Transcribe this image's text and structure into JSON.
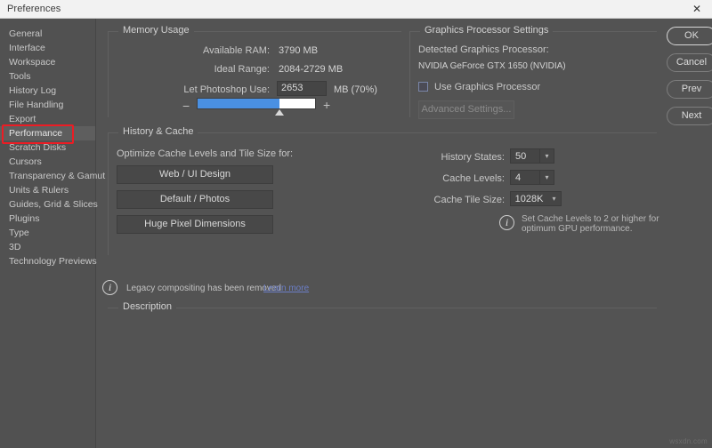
{
  "window": {
    "title": "Preferences",
    "close_icon": "close-icon"
  },
  "sidebar": {
    "items": [
      {
        "label": "General",
        "selected": false
      },
      {
        "label": "Interface",
        "selected": false
      },
      {
        "label": "Workspace",
        "selected": false
      },
      {
        "label": "Tools",
        "selected": false
      },
      {
        "label": "History Log",
        "selected": false
      },
      {
        "label": "File Handling",
        "selected": false
      },
      {
        "label": "Export",
        "selected": false
      },
      {
        "label": "Performance",
        "selected": true
      },
      {
        "label": "Scratch Disks",
        "selected": false
      },
      {
        "label": "Cursors",
        "selected": false
      },
      {
        "label": "Transparency & Gamut",
        "selected": false
      },
      {
        "label": "Units & Rulers",
        "selected": false
      },
      {
        "label": "Guides, Grid & Slices",
        "selected": false
      },
      {
        "label": "Plugins",
        "selected": false
      },
      {
        "label": "Type",
        "selected": false
      },
      {
        "label": "3D",
        "selected": false
      },
      {
        "label": "Technology Previews",
        "selected": false
      }
    ],
    "annotation_color": "#ec1c24"
  },
  "memory_usage": {
    "title": "Memory Usage",
    "available_ram_label": "Available RAM:",
    "available_ram_value": "3790 MB",
    "ideal_range_label": "Ideal Range:",
    "ideal_range_value": "2084-2729 MB",
    "let_photoshop_use_label": "Let Photoshop Use:",
    "let_photoshop_use_value": "2653",
    "unit_suffix": "MB (70%)",
    "slider_percent": 70,
    "decrease_icon": "minus-icon",
    "increase_icon": "plus-icon"
  },
  "graphics": {
    "title": "Graphics Processor Settings",
    "detected_label": "Detected Graphics Processor:",
    "detected_value": "NVIDIA GeForce GTX 1650 (NVIDIA)",
    "use_gpu_label": "Use Graphics Processor",
    "use_gpu_checked": false,
    "advanced_button": "Advanced Settings...",
    "advanced_enabled": false
  },
  "history_cache": {
    "title": "History & Cache",
    "optimize_label": "Optimize Cache Levels and Tile Size for:",
    "presets": [
      {
        "label": "Web / UI Design"
      },
      {
        "label": "Default / Photos"
      },
      {
        "label": "Huge Pixel Dimensions"
      }
    ],
    "history_states_label": "History States:",
    "history_states_value": "50",
    "cache_levels_label": "Cache Levels:",
    "cache_levels_value": "4",
    "cache_tile_size_label": "Cache Tile Size:",
    "cache_tile_size_value": "1028K",
    "hint_line1": "Set Cache Levels to 2 or higher for",
    "hint_line2": "optimum GPU performance.",
    "hint_icon": "info-icon"
  },
  "notice": {
    "icon": "info-icon",
    "text": "Legacy compositing has been removed",
    "link_label": "Learn more",
    "link_color": "#6b7ec7"
  },
  "description": {
    "title": "Description"
  },
  "actions": [
    {
      "label": "OK",
      "primary": true
    },
    {
      "label": "Cancel",
      "primary": false
    },
    {
      "label": "Prev",
      "primary": false
    },
    {
      "label": "Next",
      "primary": false
    }
  ],
  "watermark": "wsxdn.com"
}
